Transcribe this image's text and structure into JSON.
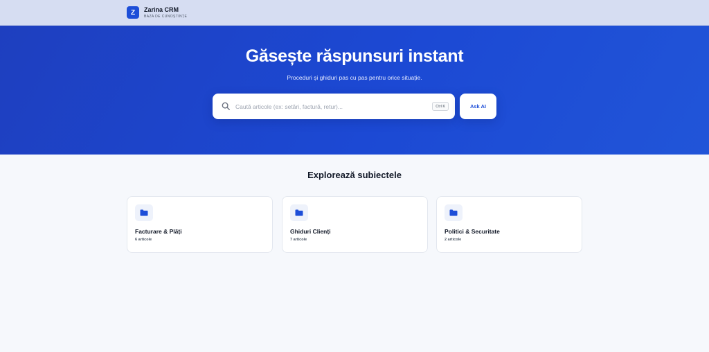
{
  "header": {
    "logo_letter": "Z",
    "app_name": "Zarina CRM",
    "app_subtitle": "Baza de cunoștințe"
  },
  "hero": {
    "title": "Găsește răspunsuri instant",
    "subtitle": "Proceduri și ghiduri pas cu pas pentru orice situație.",
    "search": {
      "placeholder": "Caută articole (ex: setări, factură, retur)...",
      "value": "",
      "shortcut": "Ctrl K",
      "icon": "search-icon"
    },
    "ask_button_label": "Ask AI"
  },
  "topics": {
    "title": "Explorează subiectele",
    "cards": [
      {
        "icon": "folder-icon",
        "title": "Facturare & Plăți",
        "count": "6 articole"
      },
      {
        "icon": "folder-icon",
        "title": "Ghiduri Clienți",
        "count": "7 articole"
      },
      {
        "icon": "folder-icon",
        "title": "Politici & Securitate",
        "count": "2 articole"
      }
    ]
  },
  "colors": {
    "accent": "#1d4ed8",
    "hero_background": "#1c49d4",
    "topbar_background": "#d6ddf2",
    "page_background": "#f6f8fc"
  }
}
